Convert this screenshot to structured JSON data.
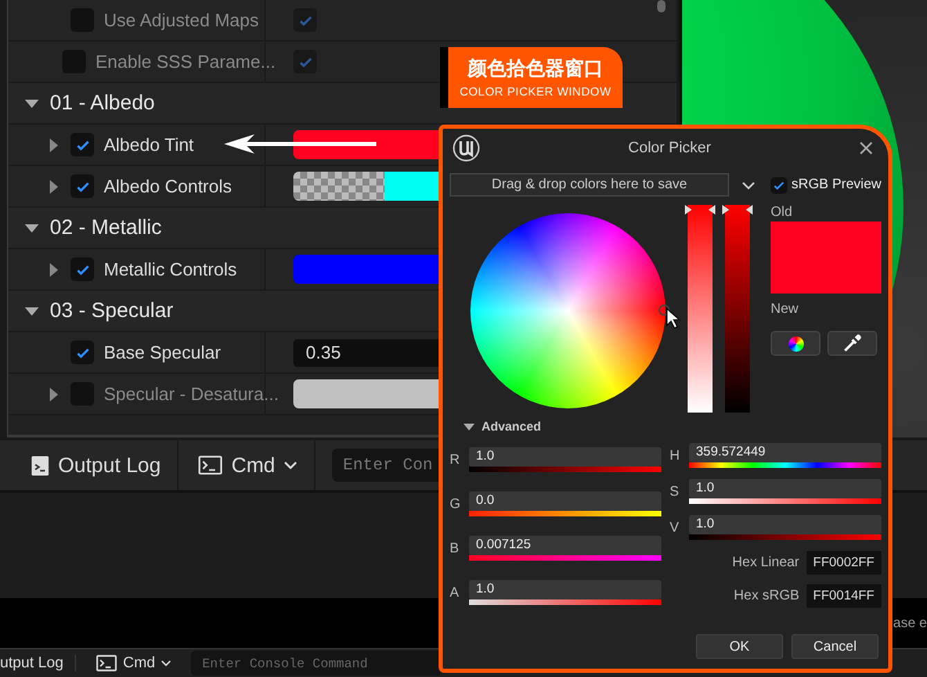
{
  "details": {
    "rows": [
      {
        "kind": "property",
        "label": "Use Adjusted Maps",
        "expandable": false,
        "checked": false,
        "value": {
          "kind": "checkbox",
          "checked": true
        }
      },
      {
        "kind": "property",
        "label": "Enable SSS Parame...",
        "expandable": false,
        "checked": false,
        "value": {
          "kind": "checkbox",
          "checked": true
        }
      },
      {
        "kind": "category",
        "label": "01 - Albedo",
        "expanded": true
      },
      {
        "kind": "property",
        "label": "Albedo Tint",
        "expandable": true,
        "checked": true,
        "value": {
          "kind": "color",
          "color": "#ff0020"
        }
      },
      {
        "kind": "property",
        "label": "Albedo Controls",
        "expandable": true,
        "checked": true,
        "value": {
          "kind": "alpha_color",
          "color": "#00fff0"
        }
      },
      {
        "kind": "category",
        "label": "02 - Metallic",
        "expanded": true
      },
      {
        "kind": "property",
        "label": "Metallic Controls",
        "expandable": true,
        "checked": true,
        "value": {
          "kind": "color",
          "color": "#0000ff"
        }
      },
      {
        "kind": "category",
        "label": "03 - Specular",
        "expanded": true
      },
      {
        "kind": "property",
        "label": "Base Specular",
        "expandable": false,
        "checked": true,
        "value": {
          "kind": "number",
          "text": "0.35"
        }
      },
      {
        "kind": "property",
        "label": "Specular - Desatura...",
        "expandable": true,
        "checked": false,
        "value": {
          "kind": "color",
          "color": "#c0c0c0"
        }
      }
    ]
  },
  "callout": {
    "title": "颜色拾色器窗口",
    "subtitle": "COLOR PICKER WINDOW"
  },
  "toolbar": {
    "output_log": "Output Log",
    "cmd": "Cmd",
    "console_placeholder": "Enter Con"
  },
  "viewport_hint": "ase e",
  "status_bar": {
    "output_log": "utput Log",
    "cmd": "Cmd",
    "console_placeholder": "Enter Console Command"
  },
  "color_picker": {
    "title": "Color Picker",
    "save_hint": "Drag & drop colors here to save",
    "srgb_preview": {
      "label": "sRGB Preview",
      "checked": true
    },
    "sliders": [
      {
        "level": 1
      },
      {
        "level": 1
      }
    ],
    "old_label": "Old",
    "new_label": "New",
    "advanced": {
      "label": "Advanced",
      "expanded": true
    },
    "rgba": [
      {
        "name": "R",
        "value": "1.0"
      },
      {
        "name": "G",
        "value": "0.0"
      },
      {
        "name": "B",
        "value": "0.007125"
      },
      {
        "name": "A",
        "value": "1.0"
      }
    ],
    "hsv": [
      {
        "name": "H",
        "value": "359.572449"
      },
      {
        "name": "S",
        "value": "1.0"
      },
      {
        "name": "V",
        "value": "1.0"
      }
    ],
    "hex": [
      {
        "label": "Hex Linear",
        "value": "FF0002FF"
      },
      {
        "label": "Hex sRGB",
        "value": "FF0014FF"
      }
    ],
    "buttons": [
      "OK",
      "Cancel"
    ]
  }
}
